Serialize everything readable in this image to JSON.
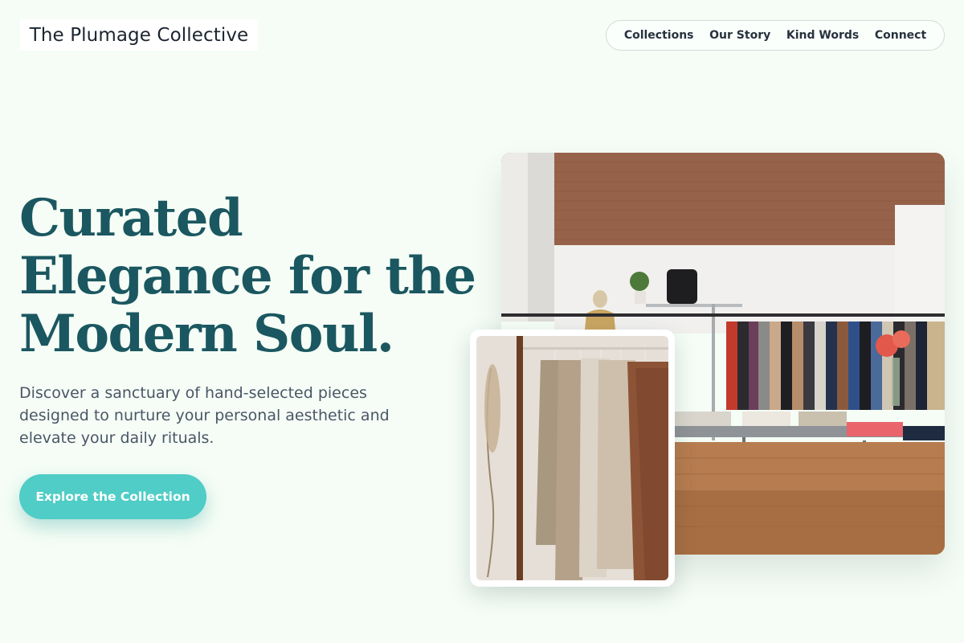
{
  "brand": {
    "name": "The Plumage Collective"
  },
  "nav": {
    "items": [
      {
        "label": "Collections"
      },
      {
        "label": "Our Story"
      },
      {
        "label": "Kind Words"
      },
      {
        "label": "Connect"
      }
    ]
  },
  "hero": {
    "headline_lines": [
      "Curated",
      "Elegance for the",
      "Modern Soul."
    ],
    "description": "Discover a sanctuary of hand-selected pieces designed to nurture your personal aesthetic and elevate your daily rituals.",
    "cta_label": "Explore the Collection"
  },
  "colors": {
    "background": "#f5fdf6",
    "headline": "#1b5760",
    "accent": "#4fcdc6",
    "text_muted": "#4a5666"
  }
}
